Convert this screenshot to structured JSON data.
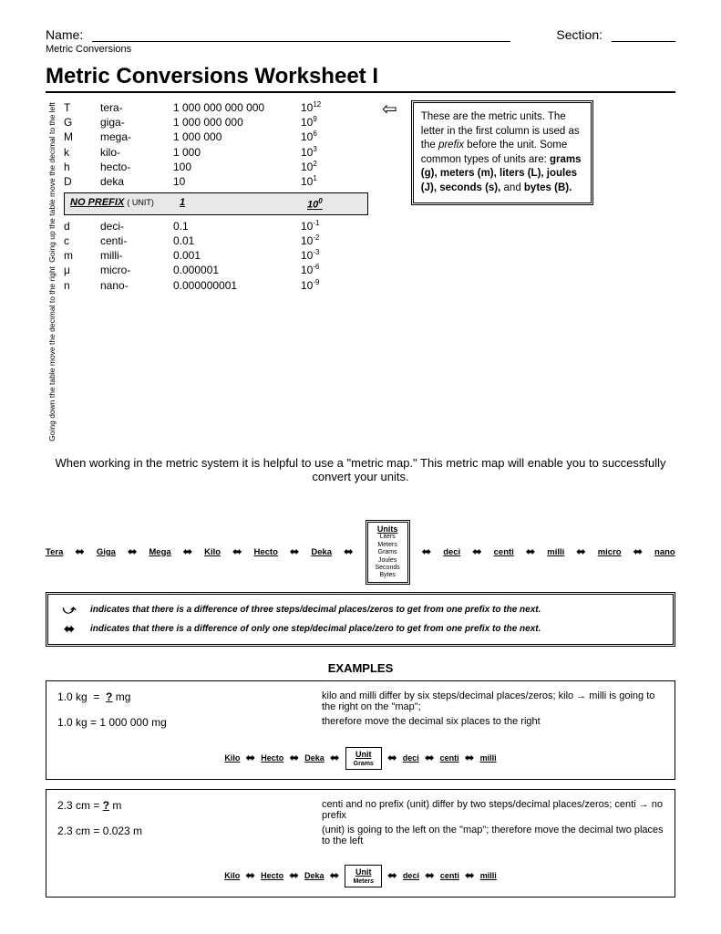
{
  "header": {
    "name_label": "Name:",
    "section_label": "Section:",
    "subtitle": "Metric Conversions"
  },
  "title": "Metric Conversions Worksheet I",
  "side_note_up": "Going up the table move the decimal to the  left",
  "side_note_down": "Going down the table move the decimal to the  right",
  "prefix_upper": [
    {
      "sym": "T",
      "name": "tera-",
      "val": "1 000 000 000 000",
      "exp": "12"
    },
    {
      "sym": "G",
      "name": "giga-",
      "val": "1 000 000 000",
      "exp": "9"
    },
    {
      "sym": "M",
      "name": "mega-",
      "val": "1 000 000",
      "exp": "6"
    },
    {
      "sym": "k",
      "name": "kilo-",
      "val": "1 000",
      "exp": "3"
    },
    {
      "sym": "h",
      "name": "hecto-",
      "val": "100",
      "exp": "2"
    },
    {
      "sym": "D",
      "name": "deka",
      "val": "10",
      "exp": "1"
    }
  ],
  "no_prefix_label": "NO PREFIX",
  "no_prefix_unit": "( UNIT)",
  "no_prefix_val": "1",
  "no_prefix_exp": "0",
  "prefix_lower": [
    {
      "sym": "d",
      "name": "deci-",
      "val": "0.1",
      "exp": "-1"
    },
    {
      "sym": "c",
      "name": "centi-",
      "val": "0.01",
      "exp": "-2"
    },
    {
      "sym": "m",
      "name": "milli-",
      "val": "0.001",
      "exp": "-3"
    },
    {
      "sym": "μ",
      "name": "micro-",
      "val": "0.000001",
      "exp": "-6"
    },
    {
      "sym": "n",
      "name": "nano-",
      "val": "0.000000001",
      "exp": "-9"
    }
  ],
  "info_box": "These are the metric units. The letter in the first column is used as the prefix before the unit.  Some common types of units are: grams (g), meters (m), liters (L), joules (J), seconds (s), and bytes (B).",
  "intro": "When working in the metric system it is helpful to use a \"metric map.\"  This metric map will enable you to successfully convert your units.",
  "map_labels": [
    "Tera",
    "Giga",
    "Mega",
    "Kilo",
    "Hecto",
    "Deka",
    "deci",
    "centi",
    "milli",
    "micro",
    "nano"
  ],
  "units_box_title": "Units",
  "units_list": [
    "Liters",
    "Meters",
    "Grams",
    "Joules",
    "Seconds",
    "Bytes"
  ],
  "legend": {
    "dashed": "indicates that there is a difference of  three steps/decimal places/zeros to get from one prefix to the next.",
    "solid": "indicates that  there is a difference of only one step/decimal place/zero to get from one prefix to the next."
  },
  "examples_label": "EXAMPLES",
  "example1": {
    "q": "1.0 kg  =  ? mg",
    "a": "1.0 kg  =  1 000 000 mg",
    "expl1": "kilo and milli differ by six steps/decimal places/zeros; kilo → milli is going to the right on the \"map\";",
    "expl2": "therefore move the decimal six places to the right",
    "labels": [
      "Kilo",
      "Hecto",
      "Deka",
      "deci",
      "centi",
      "milli"
    ],
    "unit_title": "Unit",
    "unit_sub": "Grams"
  },
  "example2": {
    "q": "2.3 cm = ? m",
    "a": "2.3 cm = 0.023 m",
    "expl1": "centi and no prefix (unit) differ by two steps/decimal places/zeros; centi → no prefix",
    "expl2": "(unit) is going to the left on the \"map\"; therefore move the decimal two places to the left",
    "labels": [
      "Kilo",
      "Hecto",
      "Deka",
      "deci",
      "centi",
      "milli"
    ],
    "unit_title": "Unit",
    "unit_sub": "Meters"
  }
}
